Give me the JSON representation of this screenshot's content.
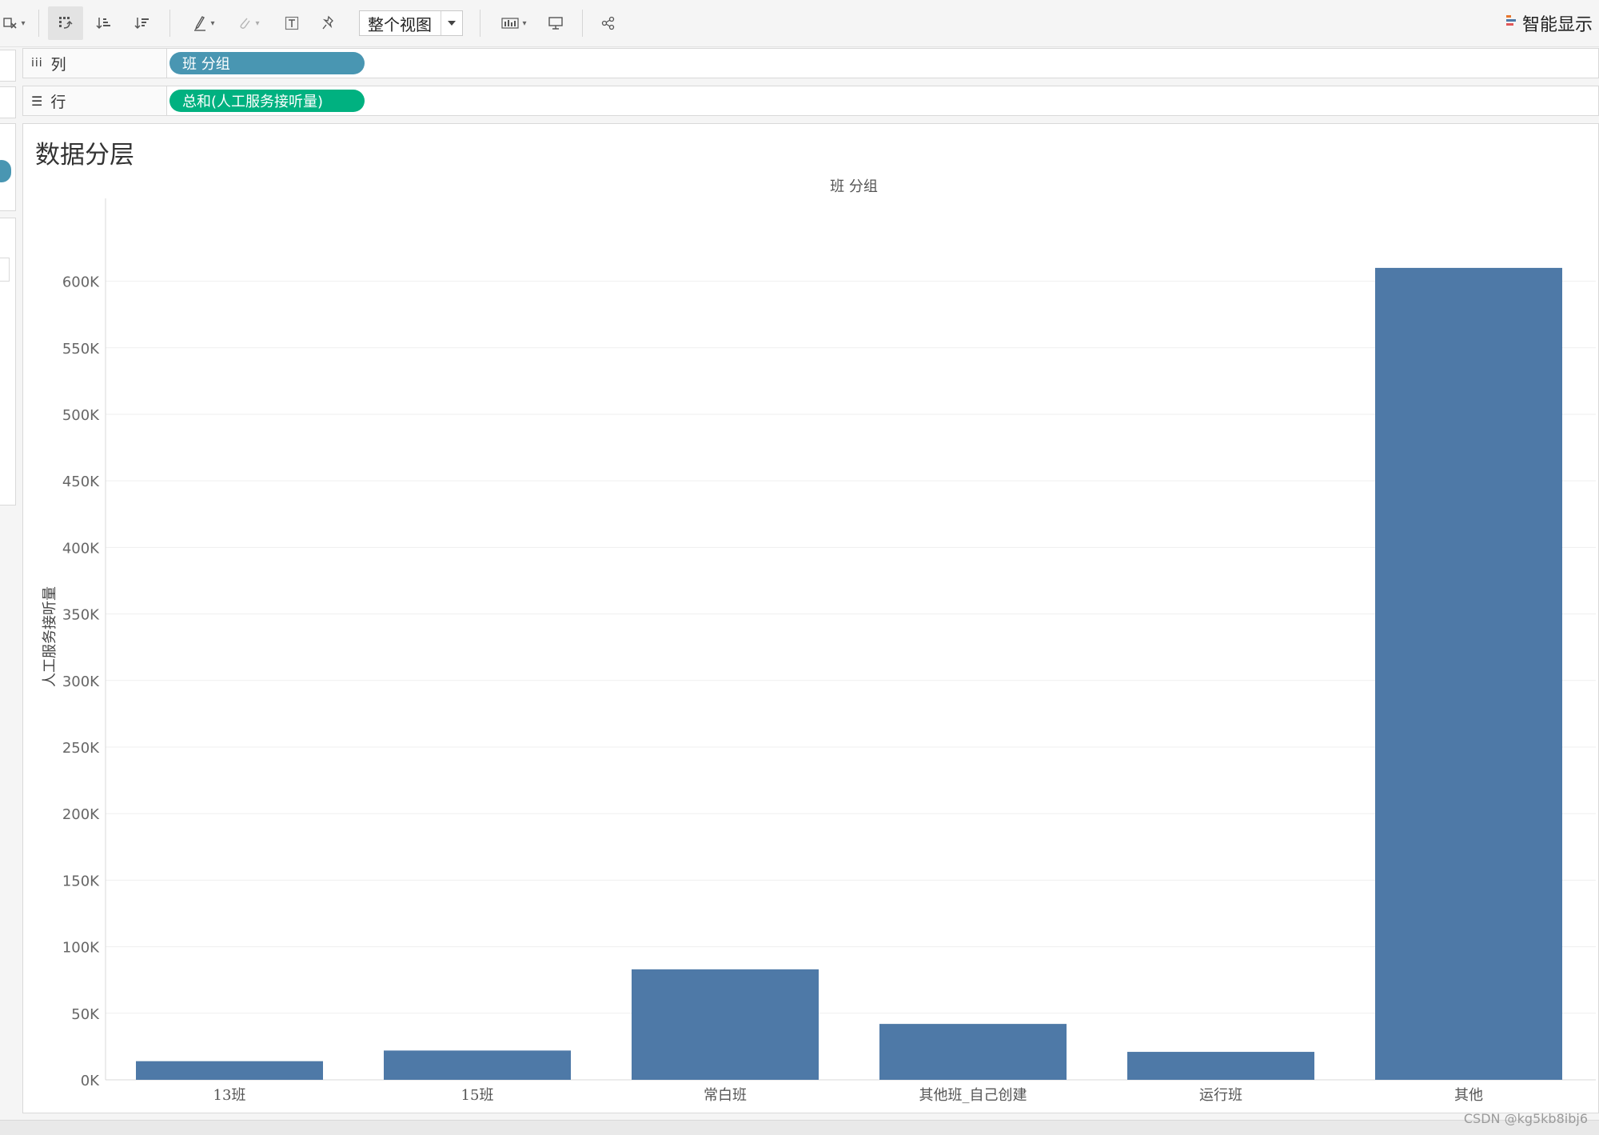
{
  "toolbar": {
    "fit_mode": "整个视图",
    "show_me_label": "智能显示",
    "icons": [
      "clear-sheet-icon",
      "swap-rows-columns-icon",
      "sort-ascending-icon",
      "sort-descending-icon",
      "highlight-icon",
      "group-icon",
      "label-icon",
      "pin-icon",
      "show-cards-icon",
      "presentation-icon",
      "share-icon"
    ]
  },
  "shelves": {
    "columns": {
      "label": "列",
      "pill": "班 分组",
      "pill_color": "#4996b2"
    },
    "rows": {
      "label": "行",
      "pill": "总和(人工服务接听量)",
      "pill_color": "#00b180"
    }
  },
  "sheet": {
    "title": "数据分层"
  },
  "chart_data": {
    "type": "bar",
    "title": "数据分层",
    "column_header": "班 分组",
    "xlabel": "",
    "ylabel": "人工服务接听量",
    "categories": [
      "13班",
      "15班",
      "常白班",
      "其他班_自己创建",
      "运行班",
      "其他"
    ],
    "values": [
      14000,
      22000,
      83000,
      42000,
      21000,
      610000
    ],
    "ylim": [
      0,
      640000
    ],
    "yticks": [
      0,
      50000,
      100000,
      150000,
      200000,
      250000,
      300000,
      350000,
      400000,
      450000,
      500000,
      550000,
      600000
    ],
    "ytick_labels": [
      "0K",
      "50K",
      "100K",
      "150K",
      "200K",
      "250K",
      "300K",
      "350K",
      "400K",
      "450K",
      "500K",
      "550K",
      "600K"
    ],
    "bar_color": "#4e79a7",
    "grid": true,
    "legend": "none"
  },
  "watermark": "CSDN @kg5kb8ibj6"
}
